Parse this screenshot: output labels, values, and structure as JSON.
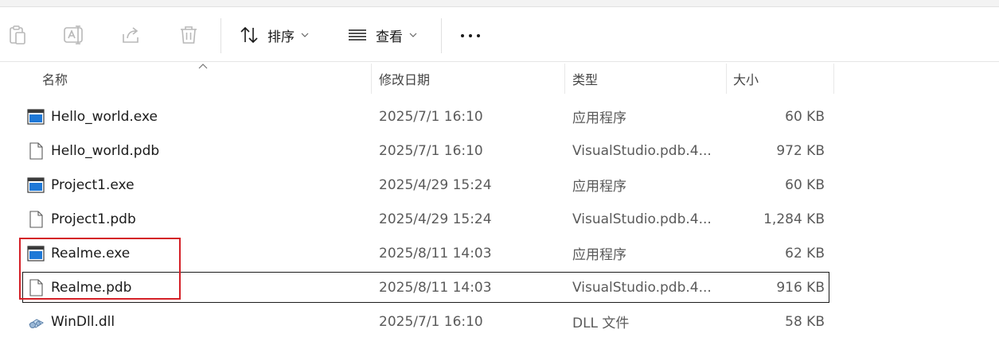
{
  "toolbar": {
    "icons": [
      "paste-icon",
      "rename-icon",
      "share-icon",
      "delete-icon"
    ],
    "sort_label": "排序",
    "view_label": "查看"
  },
  "columns": {
    "name": "名称",
    "date": "修改日期",
    "type": "类型",
    "size": "大小"
  },
  "files": [
    {
      "name": "Hello_world.exe",
      "date": "2025/7/1 16:10",
      "type": "应用程序",
      "size": "60 KB",
      "icon": "exe-icon"
    },
    {
      "name": "Hello_world.pdb",
      "date": "2025/7/1 16:10",
      "type": "VisualStudio.pdb.4...",
      "size": "972 KB",
      "icon": "file-icon"
    },
    {
      "name": "Project1.exe",
      "date": "2025/4/29 15:24",
      "type": "应用程序",
      "size": "60 KB",
      "icon": "exe-icon"
    },
    {
      "name": "Project1.pdb",
      "date": "2025/4/29 15:24",
      "type": "VisualStudio.pdb.4...",
      "size": "1,284 KB",
      "icon": "file-icon"
    },
    {
      "name": "Realme.exe",
      "date": "2025/8/11 14:03",
      "type": "应用程序",
      "size": "62 KB",
      "icon": "exe-icon"
    },
    {
      "name": "Realme.pdb",
      "date": "2025/8/11 14:03",
      "type": "VisualStudio.pdb.4...",
      "size": "916 KB",
      "icon": "file-icon"
    },
    {
      "name": "WinDll.dll",
      "date": "2025/7/1 16:10",
      "type": "DLL 文件",
      "size": "58 KB",
      "icon": "dll-icon"
    }
  ],
  "highlight_color": "#d42027"
}
